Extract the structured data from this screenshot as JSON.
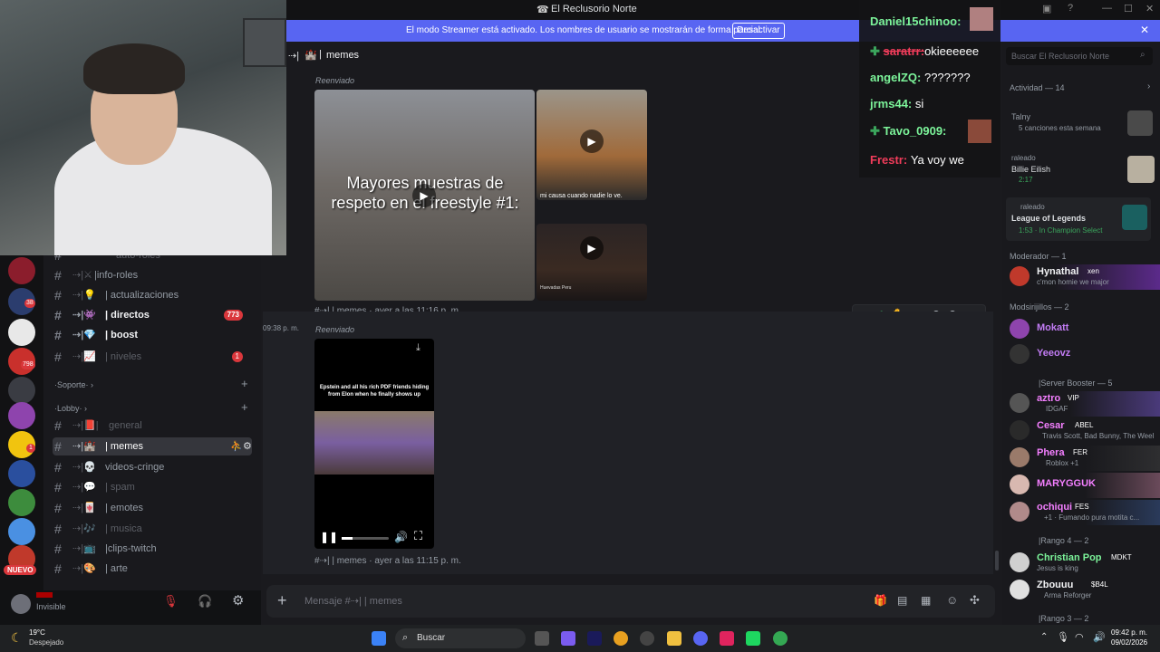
{
  "window": {
    "title": "El Reclusorio Norte"
  },
  "banner": {
    "text": "El modo Streamer está activado. Los nombres de usuario se mostrarán de forma parcial.",
    "button": "Desactivar"
  },
  "header": {
    "prefix": "⇢|",
    "channel": "memes"
  },
  "search": {
    "placeholder": "Buscar El Reclusorio Norte"
  },
  "channels": [
    {
      "name": "auto-roles",
      "style": "dim"
    },
    {
      "name": "|info-roles",
      "style": "normal"
    },
    {
      "name": "| actualizaciones",
      "style": "normal"
    },
    {
      "name": "| directos",
      "style": "bold",
      "badge": "773"
    },
    {
      "name": "| boost",
      "style": "bold"
    },
    {
      "name": "| niveles",
      "style": "dim",
      "badge": "1"
    },
    {
      "name": "general",
      "style": "dim"
    },
    {
      "name": "| memes",
      "style": "active"
    },
    {
      "name": "videos-cringe",
      "style": "normal"
    },
    {
      "name": "| spam",
      "style": "dim"
    },
    {
      "name": "| emotes",
      "style": "normal"
    },
    {
      "name": "| musica",
      "style": "dim"
    },
    {
      "name": "|clips-twitch",
      "style": "normal"
    },
    {
      "name": "| arte",
      "style": "normal"
    }
  ],
  "categories": {
    "soporte": "·Soporte·",
    "lobby": "·Lobby·"
  },
  "servers": {
    "badges": [
      "38",
      "798",
      "1"
    ],
    "new_label": "NUEVO"
  },
  "user_panel": {
    "status": "Invisible"
  },
  "messages": [
    {
      "forwarded": "Reenviado",
      "meta": "#⇢| | memes · ayer a las 11:16 p. m.",
      "overlay_text": "Mayores muestras de respeto en el freestyle #1:",
      "side_caption": "mi causa cuando nadie lo ve.",
      "small_caption": "Huevadas Peru"
    },
    {
      "time": "09:38 p. m.",
      "forwarded": "Reenviado",
      "meta": "#⇢| | memes · ayer a las 11:15 p. m.",
      "video_caption": "Epstein and all his rich PDF friends hiding from Elon when he finally shows up"
    }
  ],
  "input": {
    "placeholder": "Mensaje #⇢| | memes"
  },
  "activity": {
    "header": "Actividad — 14"
  },
  "member_groups": {
    "moderador": "Moderador — 1",
    "modsirijillos": "Modsirijillos — 2",
    "booster": "|Server Booster — 5",
    "rango4": "|Rango 4 — 2",
    "rango3": "|Rango 3 — 2"
  },
  "members": [
    {
      "name": "Talny",
      "status": "5 canciones esta semana",
      "color": "#949ba4"
    },
    {
      "name": "Billie Eilish",
      "status": "raleado",
      "extra": "2:17",
      "color": "#949ba4"
    },
    {
      "name": "League of Legends",
      "status": "raleado",
      "extra": "1:53 · In Champion Select",
      "color": "#dbdee1"
    },
    {
      "name": "Hynathal",
      "tag": "xen",
      "status": "c'mon homie we major",
      "color": "#f2f3f5"
    },
    {
      "name": "Mokatt",
      "color": "#c27cf4"
    },
    {
      "name": "Yeeovz",
      "color": "#c27cf4"
    },
    {
      "name": "aztro",
      "tag": "VIP",
      "status": "IDGAF",
      "color": "#f47fff"
    },
    {
      "name": "Cesar",
      "tag": "ABEL",
      "status": "Travis Scott, Bad Bunny, The Weel",
      "color": "#f47fff"
    },
    {
      "name": "Phera",
      "tag": "FER",
      "status": "Roblox +1",
      "color": "#f47fff"
    },
    {
      "name": "MARYGGUK",
      "color": "#f47fff"
    },
    {
      "name": "ochiqui",
      "tag": "FES",
      "status": "+1 · Fumando pura motita c...",
      "color": "#f47fff"
    },
    {
      "name": "Christian Pop",
      "tag": "MDKT",
      "status": "Jesus is king",
      "color": "#7cf49a"
    },
    {
      "name": "Zbouuu",
      "tag": "$B4L",
      "status": "Arma Reforger",
      "color": "#f2f3f5"
    }
  ],
  "chat_overlay": [
    {
      "user": "Daniel15chinoo:",
      "text": "",
      "color": "#7cf49a"
    },
    {
      "user": "saratrr:",
      "text": "okieeeeee",
      "color": "#f03c5a"
    },
    {
      "user": "angelZQ:",
      "text": "???????",
      "color": "#7cf49a"
    },
    {
      "user": "jrms44:",
      "text": "si",
      "color": "#7cf49a"
    },
    {
      "user": "Tavo_0909:",
      "text": "",
      "color": "#7cf49a"
    },
    {
      "user": "Frestr:",
      "text": "Ya voy we",
      "color": "#f03c5a"
    }
  ],
  "taskbar": {
    "weather_temp": "19°C",
    "weather_desc": "Despejado",
    "search": "Buscar",
    "time": "09:42 p. m.",
    "date": "09/02/2026"
  },
  "colors": {
    "accent": "#5865f2",
    "bg": "#1a1a1e",
    "sidebar": "#19191d"
  }
}
